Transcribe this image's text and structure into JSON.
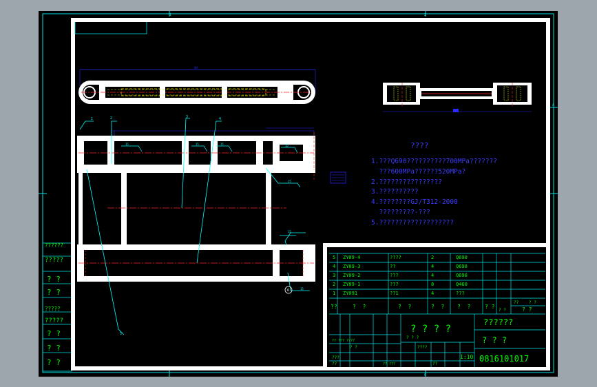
{
  "colors": {
    "viewport_bg": "#9ea6ad",
    "sheet_bg": "#000000",
    "frame_line": "#00e5e5",
    "border_white": "#ffffff",
    "text_green": "#00ff00",
    "text_blue": "#3c3cff",
    "text_yellow": "#ffff00",
    "dim_blue": "#2a2aff",
    "centerline_red": "#ff2020",
    "leader_cyan": "#00ffff",
    "hidden_yellow": "#e0e000"
  },
  "grid_labels": {
    "top_left": "1",
    "top_right": "2",
    "bottom_right": "6",
    "right_top": "A",
    "right_mid": "B"
  },
  "technical_requirements": {
    "title": "????",
    "lines": [
      "1.???Q690??????????700MPa???????",
      "  ???600MPa??????520MPa?",
      "2.????????????????",
      "3.??????????",
      "4.????????GJ/T312-2000",
      "  ?????????-???",
      "5.???????????????????"
    ]
  },
  "callouts": {
    "part_1": "1",
    "part_2": "2",
    "part_3": "3",
    "part_4": "4",
    "part_5": "5",
    "part_6": "6"
  },
  "weld_symbols": {
    "w1": "15",
    "w2": "15",
    "w3": "15",
    "w4": "15",
    "w5": "15",
    "w6": "15",
    "w7": "15"
  },
  "bom": {
    "rows": [
      {
        "no": "5",
        "code": "ZY09-4",
        "name": "????",
        "qty": "2",
        "material": "Q690"
      },
      {
        "no": "4",
        "code": "ZY09-3",
        "name": "??",
        "qty": "4",
        "material": "Q690"
      },
      {
        "no": "3",
        "code": "ZY09-2",
        "name": "???",
        "qty": "4",
        "material": "Q690"
      },
      {
        "no": "2",
        "code": "ZY09-1",
        "name": "???",
        "qty": "8",
        "material": "Q460"
      },
      {
        "no": "1",
        "code": "ZY091",
        "name": "??1",
        "qty": "4",
        "material": "???"
      }
    ],
    "header": [
      "??",
      "?  ?",
      "?  ?",
      "?  ?",
      "?  ?",
      "? ?",
      "?  ?"
    ],
    "header_right": [
      "? ?",
      "??",
      "? ?",
      "? ?"
    ]
  },
  "title_block": {
    "drawing_name": "? ? ?",
    "company": "??????",
    "part_name": "? ? ? ?",
    "drawing_number": "0816101017",
    "scale": "1:10",
    "small_labels": [
      "?? ??? ????",
      "? ?",
      "???",
      "??",
      "?? ???",
      "????",
      "??",
      "? ? ?"
    ]
  },
  "left_strip": {
    "labels": [
      "??????",
      "?????",
      "? ?",
      "? ?",
      "?????",
      "?????",
      "? ?",
      "? ?",
      "? ?"
    ]
  },
  "dimensions": {
    "top_overall": "40",
    "part_label": "?"
  }
}
